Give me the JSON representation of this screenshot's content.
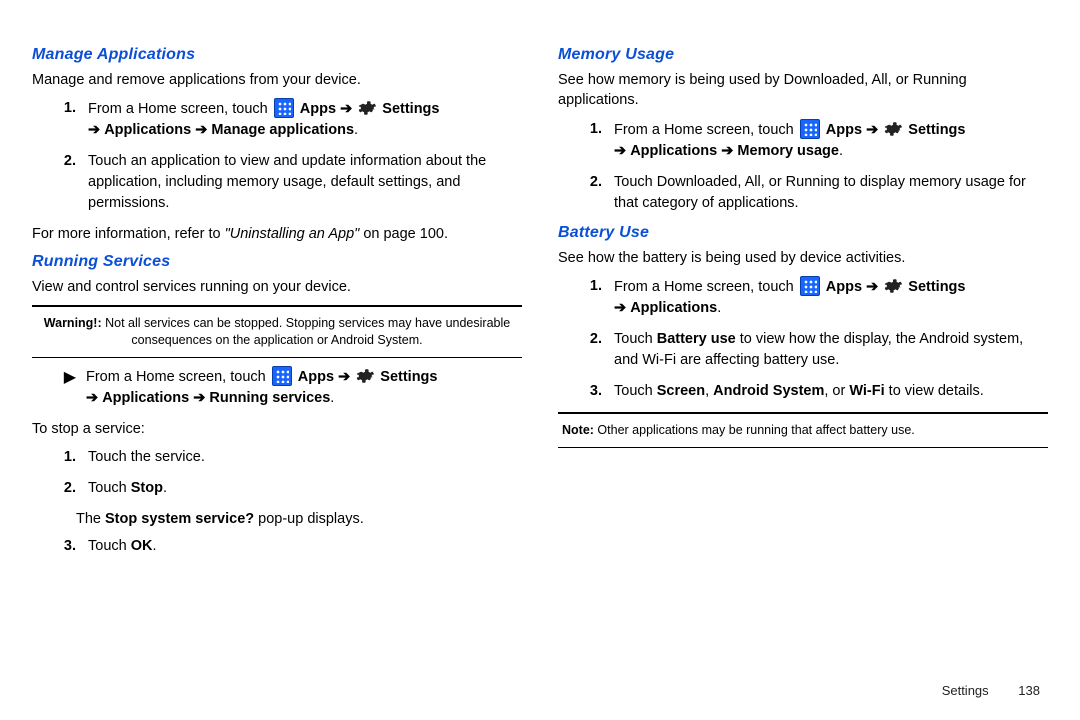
{
  "strings": {
    "apps": "Apps",
    "settings": "Settings",
    "applications": "Applications",
    "arrow": "➔",
    "from_home": "From a Home screen, touch "
  },
  "left": {
    "sec1": {
      "heading": "Manage Applications",
      "intro": "Manage and remove applications from your device.",
      "li1_path_tail": "Manage applications",
      "li2": "Touch an application to view and update information about the application, including memory usage, default settings, and permissions.",
      "ref_pre": "For more information, refer to ",
      "ref_title": "\"Uninstalling an App\"",
      "ref_post": "  on page 100."
    },
    "sec2": {
      "heading": "Running Services",
      "intro": "View and control services running on your device.",
      "warn_label": "Warning!:",
      "warn_text": " Not all services can be stopped. Stopping services may have undesirable consequences on the application or Android System.",
      "path_tail": "Running services",
      "stop_intro": "To stop a service:",
      "s1": "Touch the service.",
      "s2_pre": "Touch ",
      "s2_bold": "Stop",
      "s2_post": ".",
      "s2_sub_pre": "The ",
      "s2_sub_bold": "Stop system service?",
      "s2_sub_post": " pop-up displays.",
      "s3_pre": "Touch ",
      "s3_bold": "OK",
      "s3_post": "."
    }
  },
  "right": {
    "sec1": {
      "heading": "Memory Usage",
      "intro": "See how memory is being used by Downloaded, All, or Running applications.",
      "path_tail": "Memory usage",
      "li2": "Touch Downloaded, All, or Running to display memory usage for that category of applications."
    },
    "sec2": {
      "heading": "Battery Use",
      "intro": "See how the battery is being used by device activities.",
      "li2_pre": "Touch ",
      "li2_bold": "Battery use",
      "li2_post": " to view how the display, the Android system, and Wi-Fi are affecting battery use.",
      "li3_pre": "Touch ",
      "li3_b1": "Screen",
      "li3_mid1": ", ",
      "li3_b2": "Android System",
      "li3_mid2": ", or ",
      "li3_b3": "Wi-Fi",
      "li3_post": " to view details.",
      "note_label": "Note:",
      "note_text": " Other applications may be running that affect battery use."
    }
  },
  "footer": {
    "section": "Settings",
    "page": "138"
  }
}
